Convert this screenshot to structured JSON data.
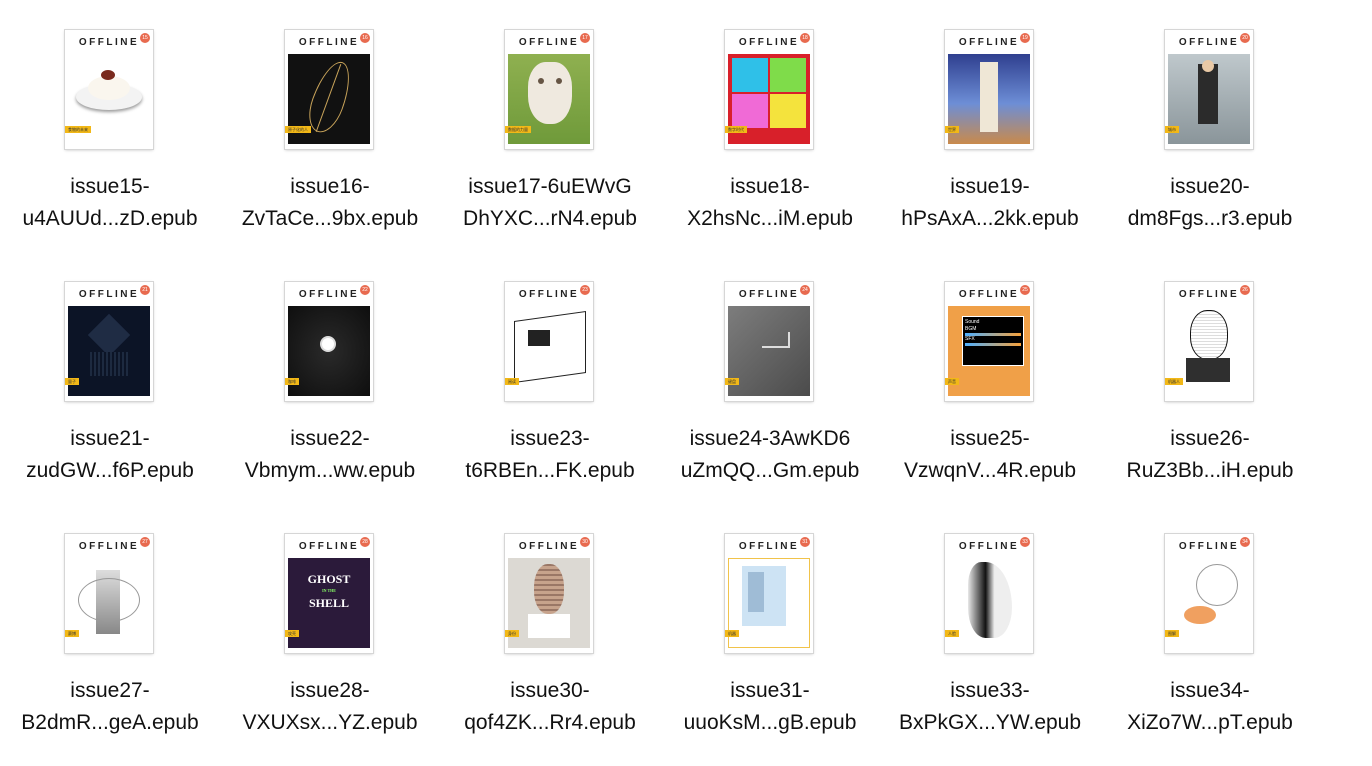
{
  "files": [
    {
      "brand": "OFFLINE",
      "issue": "15",
      "line1": "issue15-",
      "line2": "u4AUUd...zD.epub",
      "art": "rice",
      "tag": "食物的未来"
    },
    {
      "brand": "OFFLINE",
      "issue": "16",
      "line1": "issue16-",
      "line2": "ZvTaCe...9bx.epub",
      "art": "leaf",
      "tag": "原子化的人"
    },
    {
      "brand": "OFFLINE",
      "issue": "17",
      "line1": "issue17-6uEWvG",
      "line2": "DhYXC...rN4.epub",
      "art": "goat",
      "tag": "数据的力量"
    },
    {
      "brand": "OFFLINE",
      "issue": "18",
      "line1": "issue18-",
      "line2": "X2hsNc...iM.epub",
      "art": "pop",
      "tag": "数字时代"
    },
    {
      "brand": "OFFLINE",
      "issue": "19",
      "line1": "issue19-",
      "line2": "hPsAxA...2kk.epub",
      "art": "tower",
      "tag": "世界"
    },
    {
      "brand": "OFFLINE",
      "issue": "20",
      "line1": "issue20-",
      "line2": "dm8Fgs...r3.epub",
      "art": "girl",
      "tag": "城市"
    },
    {
      "brand": "OFFLINE",
      "issue": "21",
      "line1": "issue21-",
      "line2": "zudGW...f6P.epub",
      "art": "cube",
      "tag": "量子"
    },
    {
      "brand": "OFFLINE",
      "issue": "22",
      "line1": "issue22-",
      "line2": "Vbmym...ww.epub",
      "art": "coffee",
      "tag": "咖啡"
    },
    {
      "brand": "OFFLINE",
      "issue": "23",
      "line1": "issue23-",
      "line2": "t6RBEn...FK.epub",
      "art": "sketch",
      "tag": "阅读"
    },
    {
      "brand": "OFFLINE",
      "issue": "24",
      "line1": "issue24-3AwKD6",
      "line2": "uZmQQ...Gm.epub",
      "art": "keys",
      "tag": "键盘"
    },
    {
      "brand": "OFFLINE",
      "issue": "25",
      "line1": "issue25-",
      "line2": "VzwqnV...4R.epub",
      "art": "sound",
      "tag": "声音",
      "sound": {
        "title": "Sound",
        "bgm": "BGM",
        "sfx": "SFX"
      }
    },
    {
      "brand": "OFFLINE",
      "issue": "26",
      "line1": "issue26-",
      "line2": "RuZ3Bb...iH.epub",
      "art": "face",
      "tag": "机器人"
    },
    {
      "brand": "OFFLINE",
      "issue": "27",
      "line1": "issue27-",
      "line2": "B2dmR...geA.epub",
      "art": "ghost",
      "tag": "赛博"
    },
    {
      "brand": "OFFLINE",
      "issue": "28",
      "line1": "issue28-",
      "line2": "VXUXsx...YZ.epub",
      "art": "shell",
      "tag": "攻壳",
      "shell": {
        "line1": "GHOST",
        "line2": "IN THE",
        "line3": "SHELL"
      }
    },
    {
      "brand": "OFFLINE",
      "issue": "30",
      "line1": "issue30-",
      "line2": "qof4ZK...Rr4.epub",
      "art": "wrapped",
      "tag": "身份"
    },
    {
      "brand": "OFFLINE",
      "issue": "31",
      "line1": "issue31-",
      "line2": "uuoKsM...gB.epub",
      "art": "machine",
      "tag": "机器"
    },
    {
      "brand": "OFFLINE",
      "issue": "33",
      "line1": "issue33-",
      "line2": "BxPkGX...YW.epub",
      "art": "profile",
      "tag": "人脸"
    },
    {
      "brand": "OFFLINE",
      "issue": "34",
      "line1": "issue34-",
      "line2": "XiZo7W...pT.epub",
      "art": "diagram",
      "tag": "图解"
    }
  ]
}
